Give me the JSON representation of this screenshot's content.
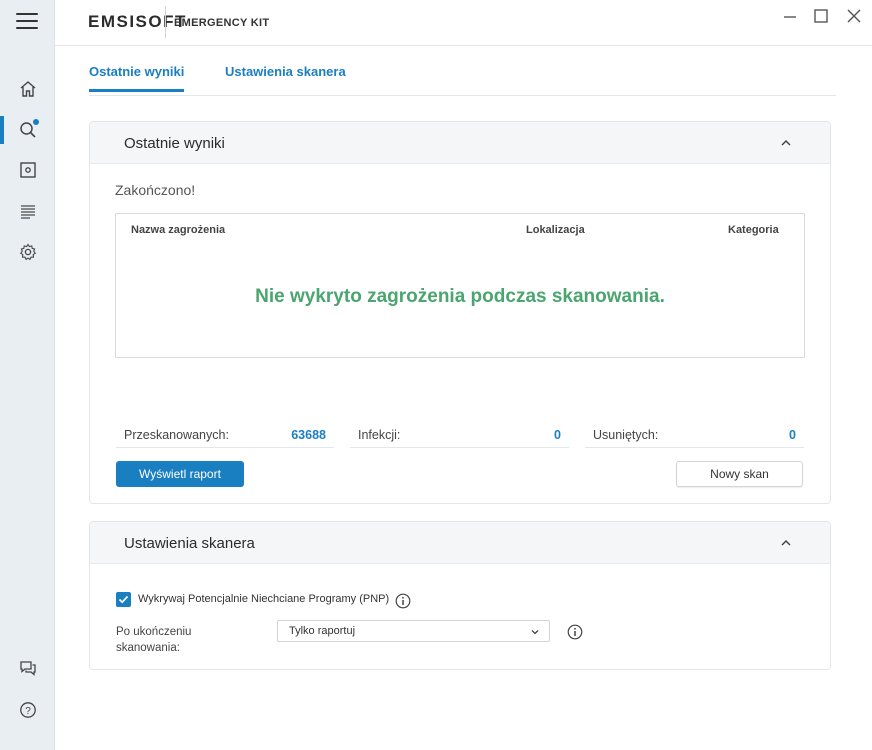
{
  "app": {
    "brand": "EMSISOFT",
    "product": "EMERGENCY KIT"
  },
  "sidebar": {
    "icons": [
      "menu-icon",
      "home-icon",
      "search-icon",
      "quarantine-icon",
      "logs-icon",
      "settings-icon",
      "chat-icon",
      "help-icon"
    ],
    "active": "search-icon"
  },
  "tabs": [
    {
      "label": "Ostatnie wyniki",
      "active": true
    },
    {
      "label": "Ustawienia skanera",
      "active": false
    }
  ],
  "results": {
    "title": "Ostatnie wyniki",
    "status": "Zakończono!",
    "columns": [
      "Nazwa zagrożenia",
      "Lokalizacja",
      "Kategoria"
    ],
    "empty_message": "Nie wykryto zagrożenia podczas skanowania.",
    "stats": [
      {
        "label": "Przeskanowanych:",
        "value": "63688"
      },
      {
        "label": "Infekcji:",
        "value": "0"
      },
      {
        "label": "Usuniętych:",
        "value": "0"
      }
    ],
    "report_button": "Wyświetl raport",
    "new_scan_button": "Nowy skan"
  },
  "scanner_settings": {
    "title": "Ustawienia skanera",
    "pup_label": "Wykrywaj Potencjalnie Niechciane Programy (PNP)",
    "pup_checked": true,
    "after_scan_label": "Po ukończeniu skanowania:",
    "after_scan_value": "Tylko raportuj"
  },
  "colors": {
    "accent": "#1a7fc1",
    "success": "#4aa56e",
    "sidebar": "#e9eef3"
  }
}
